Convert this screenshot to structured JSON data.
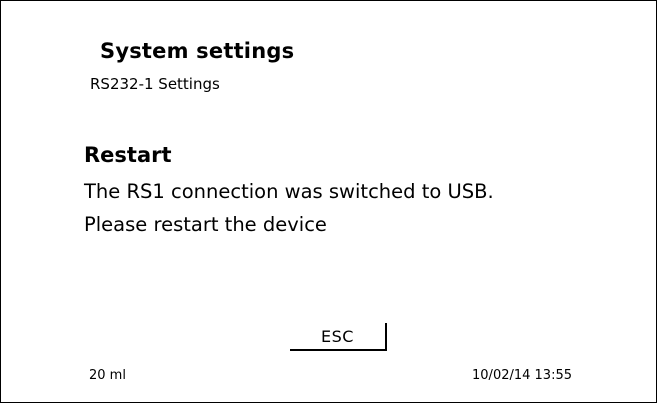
{
  "header": {
    "title": "System settings",
    "subtitle": "RS232-1 Settings"
  },
  "message": {
    "heading": "Restart",
    "line1": "The RS1 connection was switched to USB.",
    "line2": "Please restart the device"
  },
  "buttons": {
    "esc_label": "ESC"
  },
  "footer": {
    "volume": "20 ml",
    "datetime": "10/02/14 13:55"
  }
}
